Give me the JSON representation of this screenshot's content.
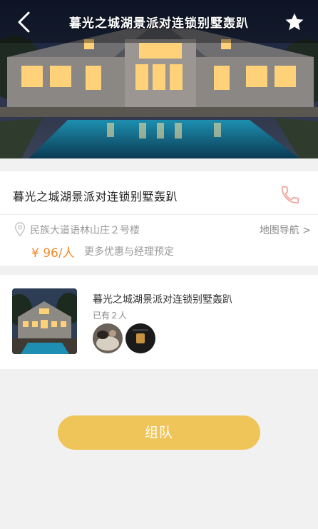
{
  "header": {
    "title": "暮光之城湖景派对连锁别墅轰趴",
    "back_icon": "chevron-left-icon",
    "favorite_icon": "star-icon"
  },
  "venue": {
    "name": "暮光之城湖景派对连锁别墅轰趴",
    "phone_icon": "phone-icon",
    "address": "民族大道语林山庄２号楼",
    "map_nav_label": "地图导航 >",
    "price": "¥ 96/人",
    "promo_text": "更多优惠与经理预定"
  },
  "team": {
    "name": "暮光之城湖景派对连锁别墅轰趴",
    "member_count": "已有２人"
  },
  "actions": {
    "join_label": "组队"
  },
  "colors": {
    "price": "#f08a2b",
    "button": "#efc459",
    "phone_icon": "#f0a59a"
  }
}
